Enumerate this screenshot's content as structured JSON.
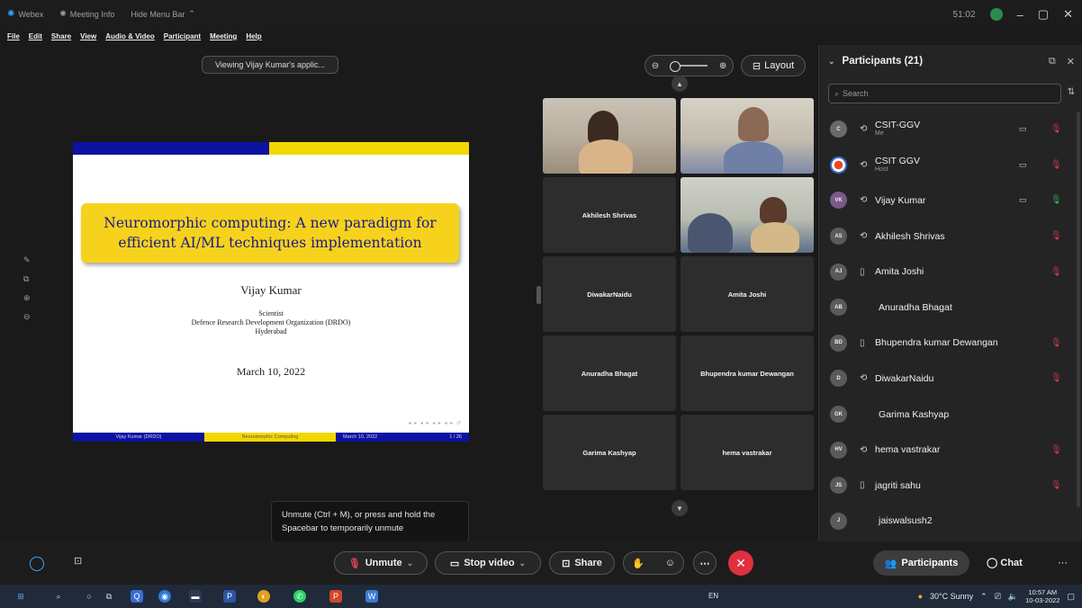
{
  "titlebar": {
    "app_name": "Webex",
    "meeting_info": "Meeting Info",
    "hide_menu": "Hide Menu Bar",
    "timer": "51:02"
  },
  "menubar": {
    "items": [
      "File",
      "Edit",
      "Share",
      "View",
      "Audio & Video",
      "Participant",
      "Meeting",
      "Help"
    ]
  },
  "share": {
    "viewing_label": "Viewing Vijay Kumar's applic..."
  },
  "slide": {
    "title": "Neuromorphic computing: A new paradigm for efficient AI/ML techniques implementation",
    "author": "Vijay Kumar",
    "role": "Scientist",
    "org": "Defence Research Development Organization (DRDO)",
    "city": "Hyderabad",
    "date": "March 10, 2022",
    "footer_left": "Vijay Kumar (DRDO)",
    "footer_mid": "Neuromorphic Computing",
    "footer_date": "March 10, 2022",
    "footer_page": "1 / 26"
  },
  "tooltip": {
    "text": "Unmute (Ctrl + M), or press and hold the Spacebar to temporarily unmute"
  },
  "video": {
    "layout_label": "Layout",
    "tiles": [
      {
        "name": "",
        "kind": "video"
      },
      {
        "name": "",
        "kind": "video"
      },
      {
        "name": "Akhilesh Shrivas",
        "kind": "name"
      },
      {
        "name": "",
        "kind": "video"
      },
      {
        "name": "DiwakarNaidu",
        "kind": "name"
      },
      {
        "name": "Amita Joshi",
        "kind": "name"
      },
      {
        "name": "Anuradha Bhagat",
        "kind": "name"
      },
      {
        "name": "Bhupendra kumar Dewangan",
        "kind": "name"
      },
      {
        "name": "Garima Kashyap",
        "kind": "name"
      },
      {
        "name": "hema vastrakar",
        "kind": "name"
      }
    ]
  },
  "participants": {
    "header": "Participants (21)",
    "search_placeholder": "Search",
    "list": [
      {
        "initials": "C",
        "name": "CSIT-GGV",
        "sub": "Me",
        "audio": "speaker",
        "camera": true,
        "mic": "muted"
      },
      {
        "initials": "",
        "name": "CSIT GGV",
        "sub": "Host",
        "audio": "speaker",
        "camera": true,
        "mic": "muted"
      },
      {
        "initials": "VK",
        "name": "Vijay Kumar",
        "sub": "",
        "audio": "speaker",
        "camera": true,
        "mic": "on"
      },
      {
        "initials": "AS",
        "name": "Akhilesh Shrivas",
        "sub": "",
        "audio": "speaker",
        "camera": false,
        "mic": "muted"
      },
      {
        "initials": "AJ",
        "name": "Amita Joshi",
        "sub": "",
        "audio": "phone",
        "camera": false,
        "mic": "muted"
      },
      {
        "initials": "AB",
        "name": "Anuradha Bhagat",
        "sub": "",
        "audio": "none",
        "camera": false,
        "mic": "none"
      },
      {
        "initials": "BD",
        "name": "Bhupendra kumar Dewangan",
        "sub": "",
        "audio": "phone",
        "camera": false,
        "mic": "muted"
      },
      {
        "initials": "D",
        "name": "DiwakarNaidu",
        "sub": "",
        "audio": "speaker",
        "camera": false,
        "mic": "muted"
      },
      {
        "initials": "GK",
        "name": "Garima Kashyap",
        "sub": "",
        "audio": "none",
        "camera": false,
        "mic": "none"
      },
      {
        "initials": "HV",
        "name": "hema vastrakar",
        "sub": "",
        "audio": "speaker",
        "camera": false,
        "mic": "muted"
      },
      {
        "initials": "JS",
        "name": "jagriti sahu",
        "sub": "",
        "audio": "phone",
        "camera": false,
        "mic": "muted"
      },
      {
        "initials": "J",
        "name": "jaiswalsush2",
        "sub": "",
        "audio": "none",
        "camera": false,
        "mic": "none"
      }
    ]
  },
  "toolbar": {
    "unmute": "Unmute",
    "stop_video": "Stop video",
    "share": "Share",
    "participants": "Participants",
    "chat": "Chat"
  },
  "taskbar": {
    "lang": "EN",
    "weather": "30°C Sunny",
    "time": "10:57 AM",
    "date": "10-03-2022"
  },
  "colors": {
    "accent_red": "#e02f3f",
    "mic_on": "#33b35a",
    "slide_blue": "#0a14a0",
    "slide_yellow": "#f3d800"
  }
}
